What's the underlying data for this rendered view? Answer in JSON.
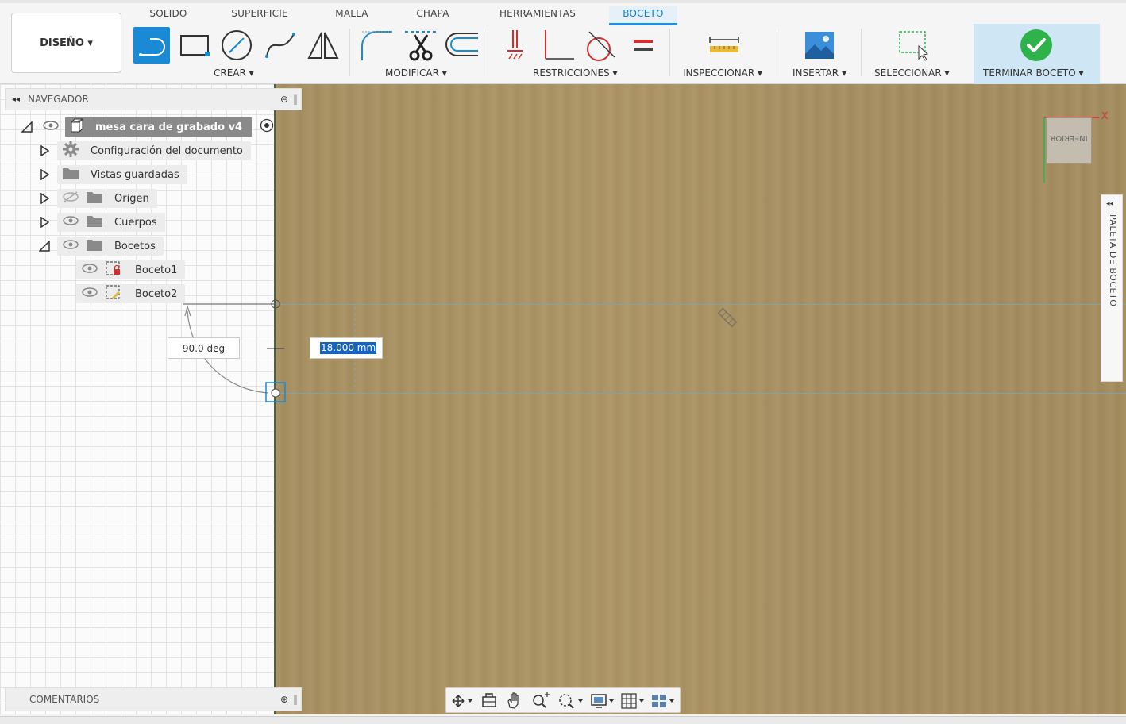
{
  "tabs": [
    "SOLIDO",
    "SUPERFICIE",
    "MALLA",
    "CHAPA",
    "HERRAMIENTAS",
    "BOCETO"
  ],
  "active_tab": "BOCETO",
  "workspace_button": "DISEÑO ▾",
  "groups": {
    "crear": "CREAR ▾",
    "modificar": "MODIFICAR ▾",
    "restricciones": "RESTRICCIONES ▾",
    "inspeccionar": "INSPECCIONAR ▾",
    "insertar": "INSERTAR ▾",
    "seleccionar": "SELECCIONAR ▾",
    "terminar": "TERMINAR BOCETO ▾"
  },
  "navigator": {
    "title": "NAVEGADOR",
    "root": "mesa cara de grabado v4",
    "items": [
      {
        "label": "Configuración del documento"
      },
      {
        "label": "Vistas guardadas"
      },
      {
        "label": "Origen"
      },
      {
        "label": "Cuerpos"
      },
      {
        "label": "Bocetos"
      },
      {
        "label": "Boceto1"
      },
      {
        "label": "Boceto2"
      }
    ]
  },
  "comments": {
    "title": "COMENTARIOS"
  },
  "dimensions": {
    "angle": "90.0 deg",
    "length": "18.000 mm"
  },
  "palette": {
    "title": "PALETA DE BOCETO"
  },
  "viewcube": {
    "face": "INFERIOR",
    "axis_x": "X"
  },
  "colors": {
    "accent": "#1993e0",
    "finish_check": "#2db34a",
    "constraint_red": "#d12f2f",
    "canvas_wood": "#a89162"
  }
}
